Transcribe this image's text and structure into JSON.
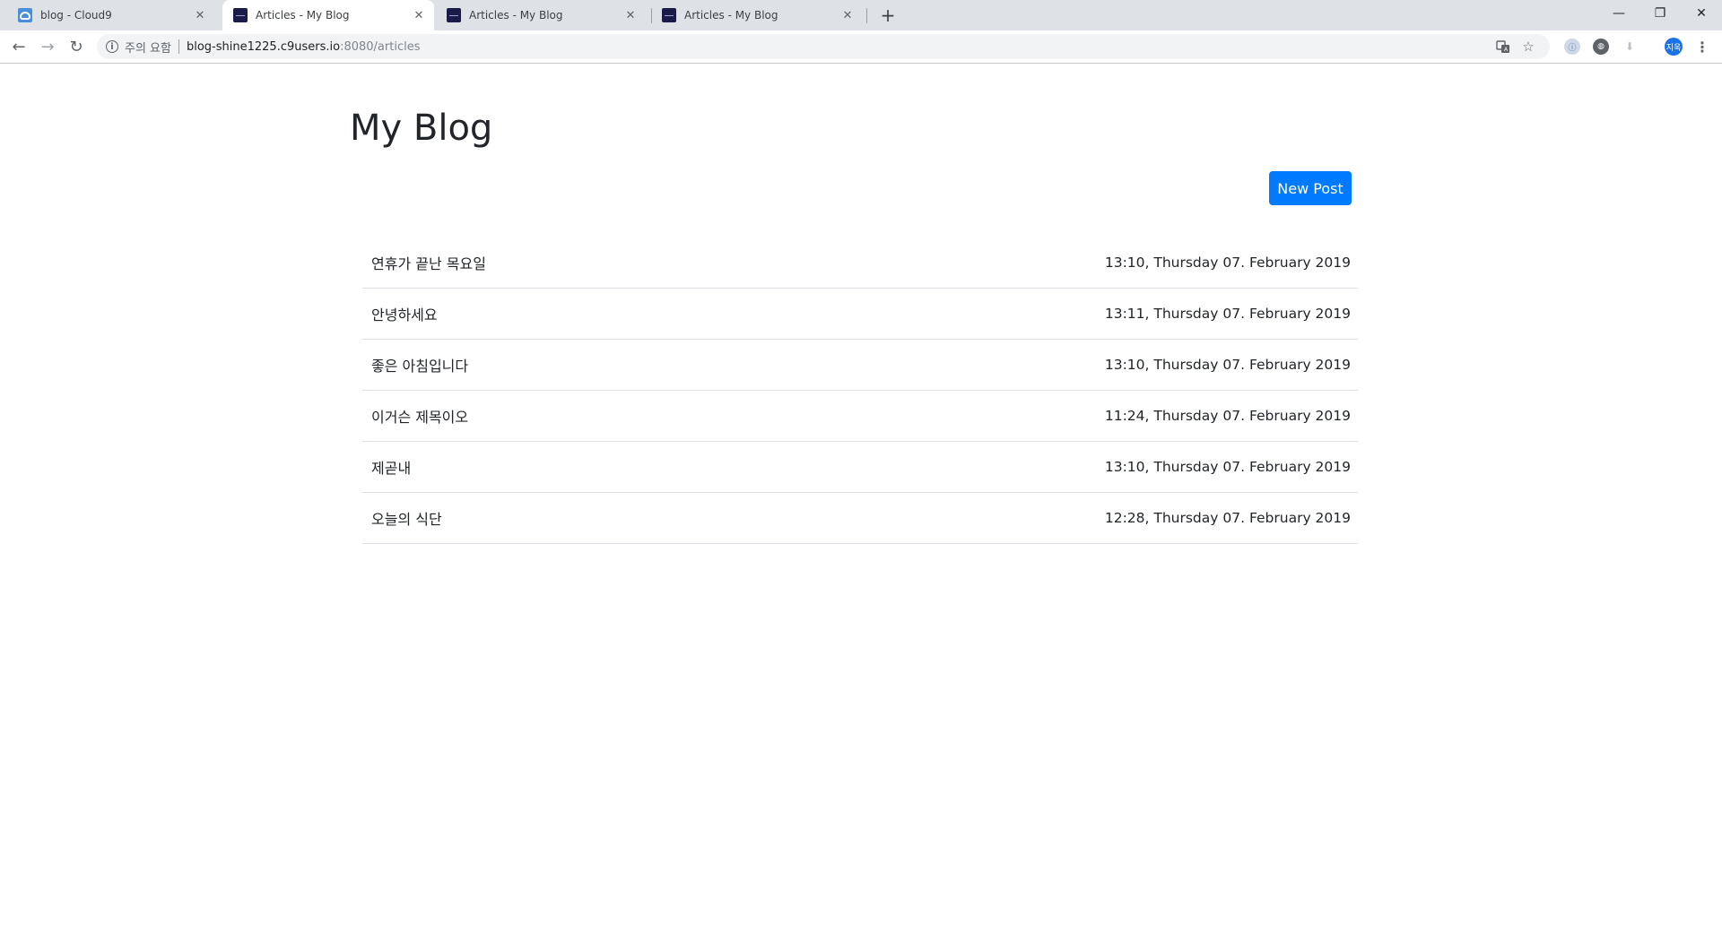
{
  "browser": {
    "tabs": [
      {
        "title": "blog - Cloud9",
        "favicon": "cloud9-icon",
        "active": false
      },
      {
        "title": "Articles - My Blog",
        "favicon": "blog-favicon-icon",
        "active": true
      },
      {
        "title": "Articles - My Blog",
        "favicon": "blog-favicon-icon",
        "active": false
      },
      {
        "title": "Articles - My Blog",
        "favicon": "blog-favicon-icon",
        "active": false
      }
    ],
    "tab_close_glyph": "✕",
    "new_tab_glyph": "+",
    "window": {
      "minimize": "—",
      "restore": "❐",
      "close": "✕"
    },
    "nav": {
      "back": "←",
      "forward": "→",
      "reload": "↻"
    },
    "address": {
      "security_label": "주의 요함",
      "host": "blog-shine1225.c9users.io",
      "path": ":8080/articles"
    },
    "profile_initials": "지욱",
    "accent_color": "#1a73e8"
  },
  "page": {
    "title": "My Blog",
    "new_post_label": "New Post",
    "button_color": "#007bff",
    "articles": [
      {
        "title": "연휴가 끝난 목요일",
        "date": "13:10, Thursday 07. February 2019"
      },
      {
        "title": "안녕하세요",
        "date": "13:11, Thursday 07. February 2019"
      },
      {
        "title": "좋은 아침입니다",
        "date": "13:10, Thursday 07. February 2019"
      },
      {
        "title": "이거슨 제목이오",
        "date": "11:24, Thursday 07. February 2019"
      },
      {
        "title": "제곧내",
        "date": "13:10, Thursday 07. February 2019"
      },
      {
        "title": "오늘의 식단",
        "date": "12:28, Thursday 07. February 2019"
      }
    ]
  }
}
